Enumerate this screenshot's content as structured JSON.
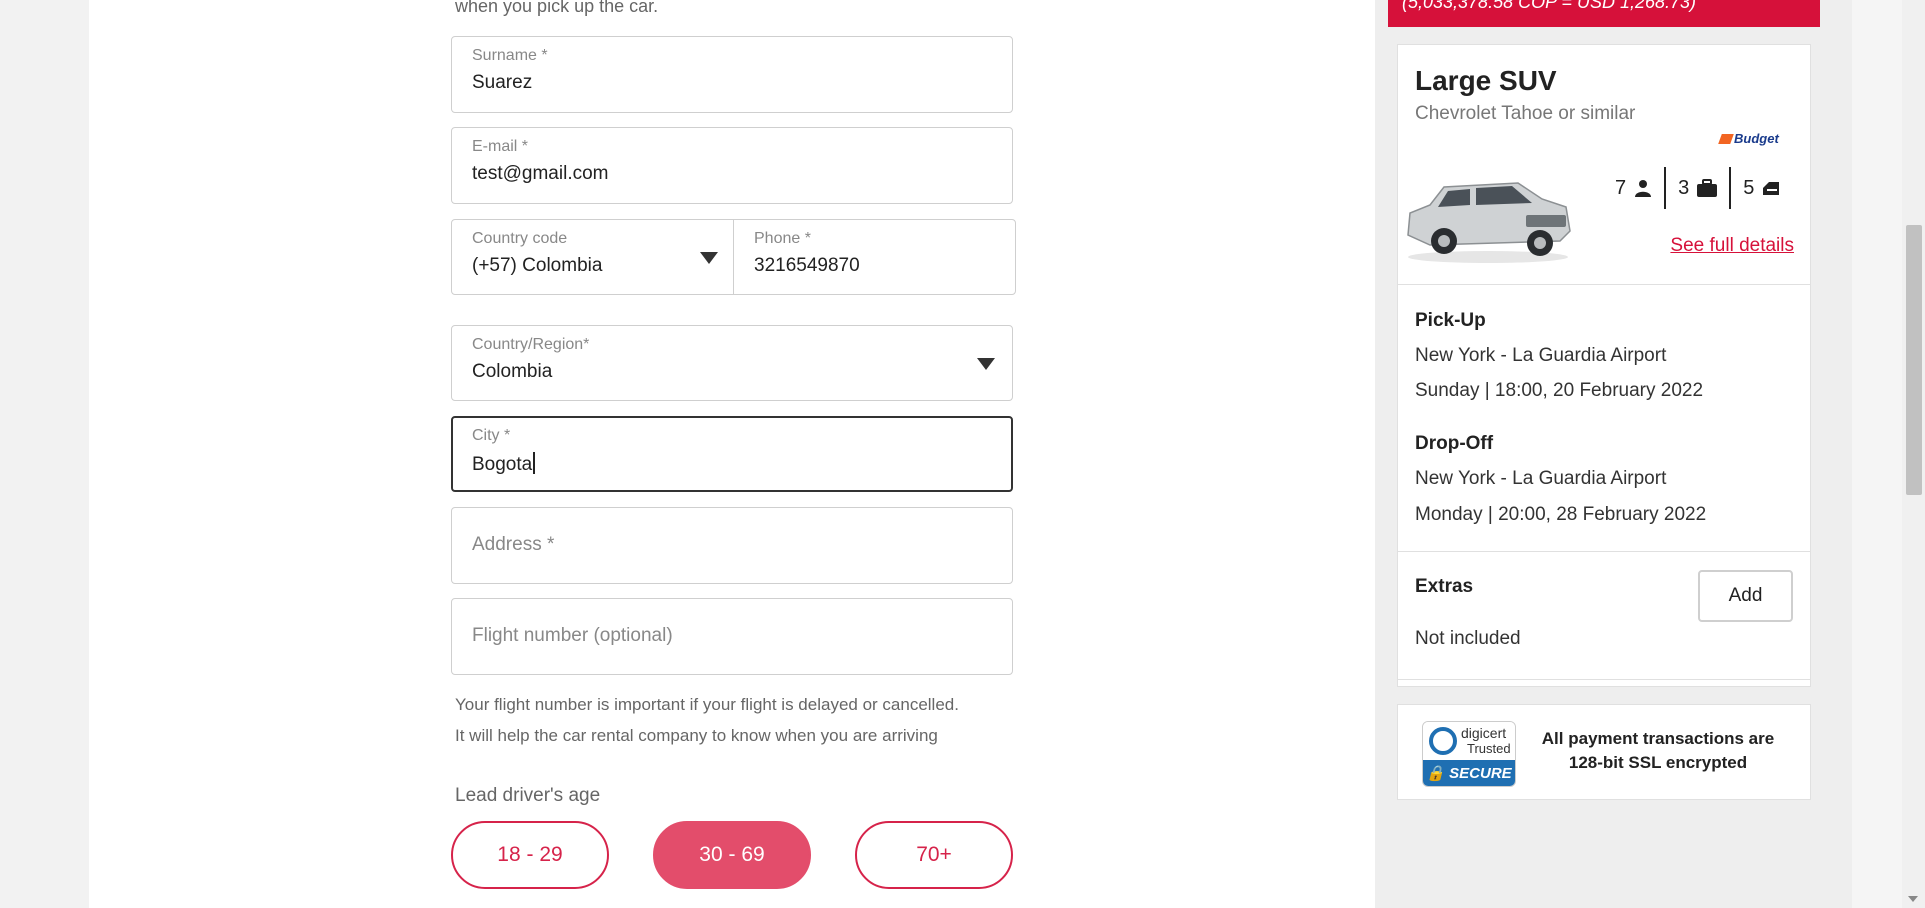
{
  "form": {
    "top_note": "when you pick up the car.",
    "surname": {
      "label": "Surname *",
      "value": "Suarez"
    },
    "email": {
      "label": "E-mail *",
      "value": "test@gmail.com"
    },
    "country_code": {
      "label": "Country code",
      "value": "(+57) Colombia"
    },
    "phone": {
      "label": "Phone *",
      "value": "3216549870"
    },
    "country_region": {
      "label": "Country/Region*",
      "value": "Colombia"
    },
    "city": {
      "label": "City *",
      "value": "Bogota"
    },
    "address": {
      "placeholder": "Address *"
    },
    "flight": {
      "placeholder": "Flight number (optional)"
    },
    "flight_help_1": "Your flight number is important if your flight is delayed or cancelled.",
    "flight_help_2": "It will help the car rental company to know when you are arriving",
    "age_label": "Lead driver's age",
    "age_options": [
      "18 - 29",
      "30 - 69",
      "70+"
    ],
    "age_selected": "30 - 69"
  },
  "sidebar": {
    "price_banner": "(5,033,378.58 COP = USD 1,268.73)",
    "car": {
      "title": "Large SUV",
      "subtitle": "Chevrolet Tahoe or similar",
      "brand": "Budget",
      "seats": "7",
      "bags": "3",
      "doors": "5",
      "details_link": "See full details"
    },
    "pickup": {
      "heading": "Pick-Up",
      "location": "New York - La Guardia Airport",
      "datetime": "Sunday | 18:00, 20 February 2022"
    },
    "dropoff": {
      "heading": "Drop-Off",
      "location": "New York - La Guardia Airport",
      "datetime": "Monday | 20:00, 28 February 2022"
    },
    "extras": {
      "heading": "Extras",
      "status": "Not included",
      "add_label": "Add"
    },
    "trust": {
      "seal_line1": "digicert",
      "seal_line2": "Trusted",
      "seal_secure": "SECURE",
      "message": "All payment transactions are 128-bit SSL encrypted"
    }
  },
  "colors": {
    "accent": "#d6113a",
    "age_selected_bg": "#e34d6b"
  }
}
